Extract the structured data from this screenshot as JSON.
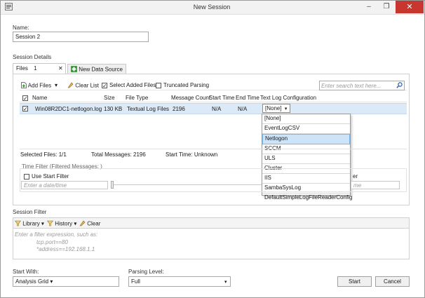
{
  "window": {
    "title": "New Session",
    "minimize_glyph": "–",
    "restore_glyph": "❐",
    "close_glyph": "✕"
  },
  "name_section": {
    "label": "Name:",
    "value": "Session 2"
  },
  "session_details": {
    "label": "Session Details",
    "tabs": [
      {
        "label": "Files",
        "count": "1",
        "close_glyph": "✕"
      },
      {
        "label": "New Data Source"
      }
    ],
    "toolbar": {
      "add_files": "Add Files",
      "clear_list": "Clear List",
      "select_added_files": "Select Added Files",
      "truncated_parsing": "Truncated Parsing",
      "search_placeholder": "Enter search text here..."
    },
    "columns": [
      "Name",
      "Size",
      "File Type",
      "Message Count",
      "Start Time",
      "End Time",
      "Text Log Configuration"
    ],
    "rows": [
      {
        "name": "Win08R2DC1-netlogon.log",
        "size": "130 KB",
        "file_type": "Textual Log Files",
        "message_count": "2196",
        "start_time": "N/A",
        "end_time": "N/A",
        "config": "[None]"
      }
    ],
    "config_options": [
      "[None]",
      "EventLogCSV",
      "Netlogon",
      "SCCM",
      "ULS",
      "Cluster",
      "IIS",
      "SambaSysLog",
      "DefaultSimpleLogFileReaderConfig"
    ],
    "config_selected": "Netlogon",
    "summary": {
      "selected_files": "Selected Files: 1/1",
      "total_messages": "Total Messages: 2196",
      "start_time": "Start Time: Unknown"
    },
    "time_filter": {
      "label": "Time Filter (Filtered Messages:  )",
      "use_start_filter": "Use Start Filter",
      "date_placeholder": "Enter a date/time",
      "right_label_fragment": "er",
      "right_placeholder_fragment": "me"
    }
  },
  "session_filter": {
    "label": "Session Filter",
    "library": "Library",
    "history": "History",
    "clear": "Clear",
    "placeholder_lines": [
      "Enter a filter expression, such as:",
      "tcp.port==80",
      "*address==192.168.1.1"
    ]
  },
  "footer": {
    "start_with_label": "Start With:",
    "start_with_value": "Analysis Grid",
    "parsing_level_label": "Parsing Level:",
    "parsing_level_value": "Full",
    "start_button": "Start",
    "cancel_button": "Cancel"
  },
  "colors": {
    "selected_row": "#dce9f6",
    "dropdown_highlight": "#cde3f7",
    "close_button": "#c7372f",
    "add_icon": "#3a9a3a"
  },
  "icons": [
    "app-icon",
    "add-files-icon",
    "clear-list-icon",
    "search-icon",
    "add-data-source-icon",
    "library-icon",
    "history-icon",
    "clear-filter-icon"
  ]
}
